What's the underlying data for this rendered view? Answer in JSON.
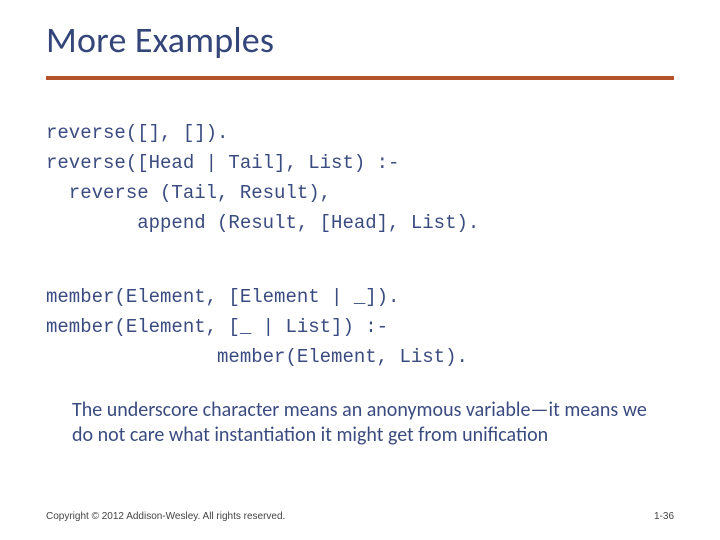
{
  "slide": {
    "title": "More Examples",
    "code1": "reverse([], []).\nreverse([Head | Tail], List) :-\n  reverse (Tail, Result),\n        append (Result, [Head], List).",
    "code2": "member(Element, [Element | _]).\nmember(Element, [_ | List]) :-\n               member(Element, List).",
    "body": "The underscore character means an anonymous variable—it means we do not care what instantiation it might get from unification",
    "copyright": "Copyright © 2012 Addison-Wesley. All rights reserved.",
    "pagenum": "1-36"
  }
}
